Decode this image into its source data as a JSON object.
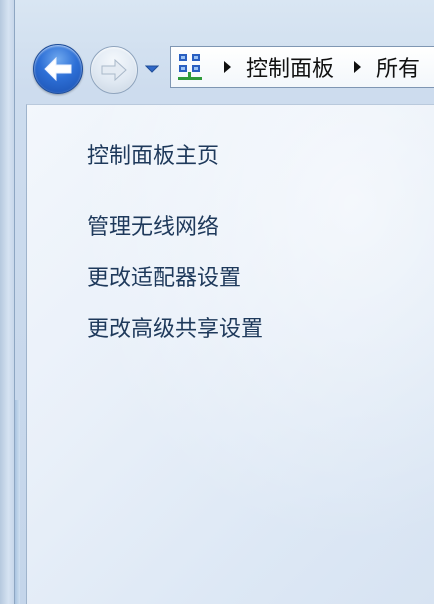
{
  "navigation": {
    "back_icon": "back-arrow-icon",
    "forward_icon": "forward-arrow-icon",
    "dropdown_icon": "chevron-down-icon"
  },
  "address_bar": {
    "icon": "network-icon",
    "breadcrumbs": [
      {
        "label": "控制面板"
      },
      {
        "label": "所有"
      }
    ]
  },
  "sidebar": {
    "home_link": "控制面板主页",
    "tasks": [
      {
        "label": "管理无线网络"
      },
      {
        "label": "更改适配器设置"
      },
      {
        "label": "更改高级共享设置"
      }
    ]
  },
  "colors": {
    "link_text": "#1e395b",
    "back_button": "#2d6fd6"
  }
}
